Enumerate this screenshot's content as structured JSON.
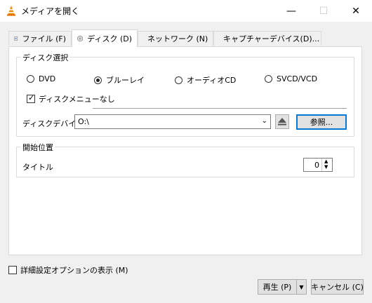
{
  "window": {
    "title": "メディアを開く",
    "icon": "vlc-cone-icon",
    "minimize": "—",
    "maximize": "☐",
    "close": "✕"
  },
  "tabs": [
    {
      "label": "ファイル (F)",
      "icon": "file-play-icon",
      "active": false
    },
    {
      "label": "ディスク (D)",
      "icon": "disc-icon",
      "active": true
    },
    {
      "label": "ネットワーク (N)",
      "icon": "network-icon",
      "active": false
    },
    {
      "label": "キャプチャーデバイス(D)...",
      "icon": "capture-card-icon",
      "active": false
    }
  ],
  "disc_selection": {
    "group_label": "ディスク選択",
    "options": [
      {
        "label": "DVD",
        "selected": false
      },
      {
        "label": "ブルーレイ",
        "selected": true
      },
      {
        "label": "オーディオCD",
        "selected": false
      },
      {
        "label": "SVCD/VCD",
        "selected": false
      }
    ],
    "no_disc_menu": {
      "label": "ディスクメニューなし",
      "checked": true
    },
    "device_label": "ディスクデバイス",
    "device_value": "O:\\",
    "browse_label": "参照..."
  },
  "start_position": {
    "group_label": "開始位置",
    "title_label": "タイトル",
    "title_value": "0"
  },
  "advanced": {
    "label": "詳細設定オプションの表示 (M)",
    "checked": false
  },
  "footer": {
    "play_label": "再生 (P)",
    "cancel_label": "キャンセル (C)"
  }
}
